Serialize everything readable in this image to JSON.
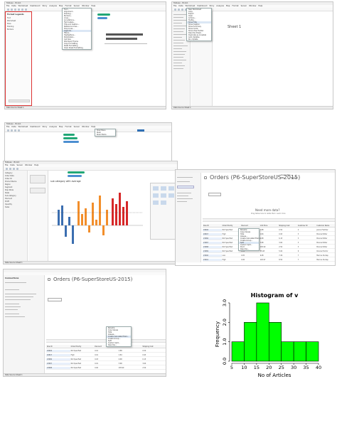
{
  "panel1": {
    "title": "Tableau - Book1",
    "menus": [
      "File",
      "Data",
      "Worksheet",
      "Dashboard",
      "Story",
      "Analysis",
      "Map",
      "Format",
      "Server",
      "Window",
      "Help"
    ],
    "side_header": "Format Legends",
    "side_items": [
      "Font",
      "Worksheet",
      "Pane",
      "Shading",
      "Borders"
    ],
    "dropdown_items": [
      "Font...",
      "Alignment...",
      "Shading...",
      "Borders...",
      "Lines...",
      "Annotations...",
      "Field Labels...",
      "Title and Caption...",
      "Reference Lines...",
      "Drop Lines...",
      "Legends...",
      "Filters...",
      "Highlighters...",
      "Parameters...",
      "Cell Size",
      "Workbook Theme",
      "Copy Formatting",
      "Paste Formatting",
      "Clear Sheet Formatting"
    ],
    "dropdown_highlight_index": 10,
    "pills": [
      "Sub-Category",
      "SUM(Sales)"
    ],
    "status": "Data Source    Sheet 1"
  },
  "panel2": {
    "title": "Tableau - Book1",
    "menus": [
      "File",
      "Data",
      "Worksheet",
      "Dashboard",
      "Story",
      "Analysis",
      "Map",
      "Format",
      "Server",
      "Window",
      "Help"
    ],
    "sheet_title": "Sheet 1",
    "dropdown_items": [
      "New Worksheet",
      "Copy",
      "Export",
      "Clear",
      "Actions...",
      "Tooltip...",
      "Show Title",
      "Show Caption",
      "Show Summary",
      "Show Cards",
      "Show View Toolbar",
      "Describe Sheet...",
      "Duplicate as Crosstab",
      "Auto Updates",
      "Run Update"
    ],
    "dropdown_highlight_index": 6,
    "status": "Data Source    Sheet 1"
  },
  "panel3": {
    "title": "Tableau - Book1",
    "menus": [
      "File",
      "Data",
      "Worksheet",
      "Dashboard",
      "Story",
      "Analysis",
      "Map",
      "Format",
      "Server",
      "Window",
      "Help"
    ],
    "dropdown_items": [
      "Shell Menu",
      "Ruler",
      "Ruler Marks"
    ],
    "pill_labels": [
      "Category",
      "Sub-Category",
      "SUM(Profit)",
      "AVG(Sales)"
    ]
  },
  "panel4": {
    "title": "Tableau - Book1",
    "menus": [
      "File",
      "Data",
      "Server",
      "Window",
      "Help"
    ],
    "chart_title": "sub category with average",
    "side_items": [
      "Category",
      "Order Date",
      "Order ID",
      "Product Name",
      "Region",
      "Segment",
      "Ship Mode",
      "State",
      "Sub-Category",
      "Discount",
      "Profit",
      "Quantity",
      "Sales"
    ],
    "status": "Data Source    Sheet 1"
  },
  "panel5": {
    "orders_title": "Orders (P6-SuperStoreUS-2015)",
    "connection_label": "Connection",
    "live_label": "Live",
    "extract_label": "Extract",
    "need_more_data": "Need more data?",
    "drag_hint": "Drag tables here to relate them. Learn more",
    "columns": [
      "Row ID",
      "Order Priority",
      "Discount",
      "Unit Price",
      "Shipping Cost",
      "Customer ID",
      "Customer Name"
    ],
    "rows": [
      [
        "18606",
        "Not Specified",
        "0.01",
        "2.88",
        "0.50",
        "2",
        "Janice Fletcher"
      ],
      [
        "20847",
        "High",
        "0.01",
        "2.84",
        "0.93",
        "3",
        "Bonnie Potter"
      ],
      [
        "23086",
        "Not Specified",
        "0.03",
        "6.68",
        "6.15",
        "3",
        "Bonnie Potter"
      ],
      [
        "23087",
        "Not Specified",
        "0.01",
        "5.68",
        "3.60",
        "3",
        "Bonnie Potter"
      ],
      [
        "23088",
        "Not Specified",
        "0.00",
        "205.99",
        "2.50",
        "3",
        "Bonnie Potter"
      ],
      [
        "23089",
        "Not Specified",
        "0.09",
        "55.48",
        "5.00",
        "6",
        "Ronnie Proctor"
      ],
      [
        "23090",
        "Low",
        "0.05",
        "9.48",
        "7.29",
        "7",
        "Marcus Dunlap"
      ],
      [
        "23091",
        "High",
        "0.06",
        "120.97",
        "8.50",
        "7",
        "Marcus Dunlap"
      ]
    ],
    "context_items": [
      "Rename",
      "Copy Values",
      "Hide",
      "Aliases...",
      "Create Calculated Field...",
      "Create Group...",
      "Split",
      "Custom Split...",
      "Pivot",
      "Describe..."
    ],
    "context_highlight_index": 6
  },
  "panel6": {
    "orders_title": "Orders (P6-SuperStoreUS-2015)",
    "side_title": "Connections",
    "context_items": [
      "Rename",
      "Copy Values",
      "Hide",
      "Aliases...",
      "Create Calculated Field...",
      "Create Group...",
      "Split",
      "Custom Split...",
      "Describe..."
    ],
    "context_highlight_index": 4,
    "columns": [
      "Row ID",
      "Order Priority",
      "Discount",
      "Unit Price",
      "Shipping Cost"
    ],
    "rows": [
      [
        "18606",
        "Not Specified",
        "0.01",
        "2.88",
        "0.50"
      ],
      [
        "20847",
        "High",
        "0.01",
        "2.84",
        "0.93"
      ],
      [
        "23086",
        "Not Specified",
        "0.03",
        "6.68",
        "6.15"
      ],
      [
        "23087",
        "Not Specified",
        "0.01",
        "5.68",
        "3.60"
      ],
      [
        "23088",
        "Not Specified",
        "0.00",
        "205.99",
        "2.50"
      ]
    ],
    "status": "Data Source    Sheet 1"
  },
  "chart_data": {
    "type": "bar",
    "title": "Histogram of v",
    "xlabel": "No of Articles",
    "ylabel": "Frequency",
    "bins": [
      [
        5,
        10
      ],
      [
        10,
        15
      ],
      [
        15,
        20
      ],
      [
        20,
        25
      ],
      [
        25,
        30
      ],
      [
        30,
        35
      ],
      [
        35,
        40
      ]
    ],
    "values": [
      1,
      2,
      3,
      2,
      1,
      1,
      1
    ],
    "xticks": [
      5,
      10,
      15,
      20,
      25,
      30,
      35,
      40
    ],
    "yticks": [
      "0.0",
      "1.0",
      "2.0",
      "3.0"
    ],
    "xlim": [
      5,
      40
    ],
    "ylim": [
      0,
      3
    ],
    "bar_color": "#00ff00",
    "edge_color": "#000000"
  },
  "colors": {
    "pill_green": "#22a776",
    "pill_blue": "#4c8fd0",
    "tableau_blue": "#2f6fb5",
    "bar_blue": "#3b6eb0",
    "bar_orange": "#f28e2b",
    "bar_red": "#d62728"
  }
}
